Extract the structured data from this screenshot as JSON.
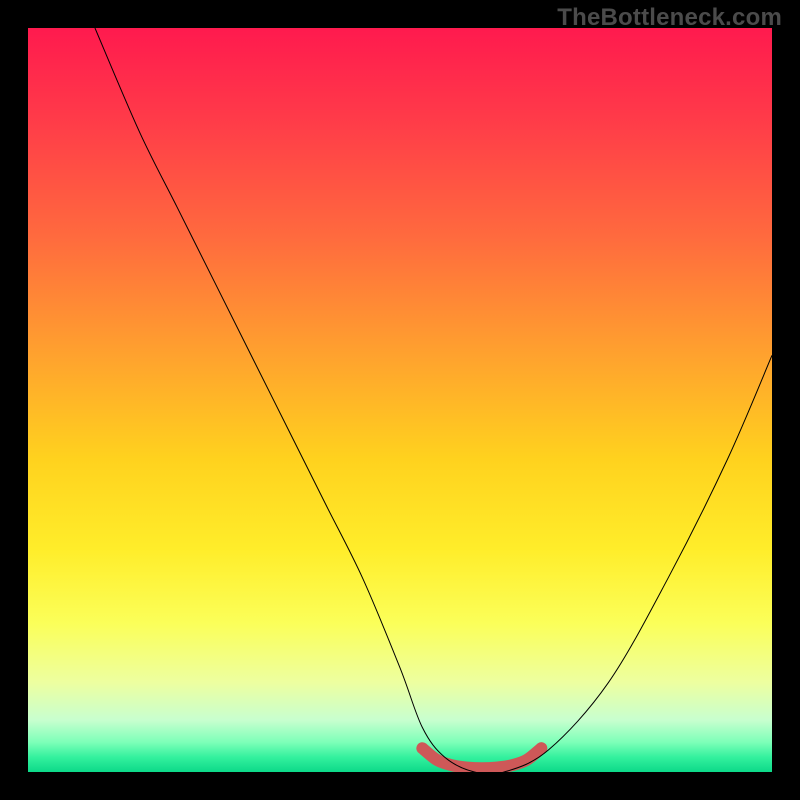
{
  "watermark": "TheBottleneck.com",
  "chart_data": {
    "type": "line",
    "title": "",
    "xlabel": "",
    "ylabel": "",
    "xlim": [
      0,
      100
    ],
    "ylim": [
      0,
      100
    ],
    "grid": false,
    "background_gradient": [
      "#ff1a4e",
      "#ff6a3e",
      "#ffd21e",
      "#fbff59",
      "#c8ffcf",
      "#0cd989"
    ],
    "series": [
      {
        "name": "bottleneck-curve",
        "color": "#000000",
        "x": [
          9,
          15,
          20,
          25,
          30,
          35,
          40,
          45,
          50,
          53,
          56,
          60,
          64,
          70,
          78,
          86,
          94,
          100
        ],
        "y": [
          100,
          86,
          76,
          66,
          56,
          46,
          36,
          26,
          14,
          6,
          2,
          0,
          0,
          3,
          12,
          26,
          42,
          56
        ]
      },
      {
        "name": "tolerance-band",
        "color": "#ce5858",
        "x": [
          53,
          55,
          57,
          59,
          61,
          63,
          65,
          67,
          69
        ],
        "y": [
          3.2,
          1.6,
          0.9,
          0.6,
          0.5,
          0.6,
          0.9,
          1.6,
          3.2
        ]
      }
    ],
    "annotations": []
  }
}
